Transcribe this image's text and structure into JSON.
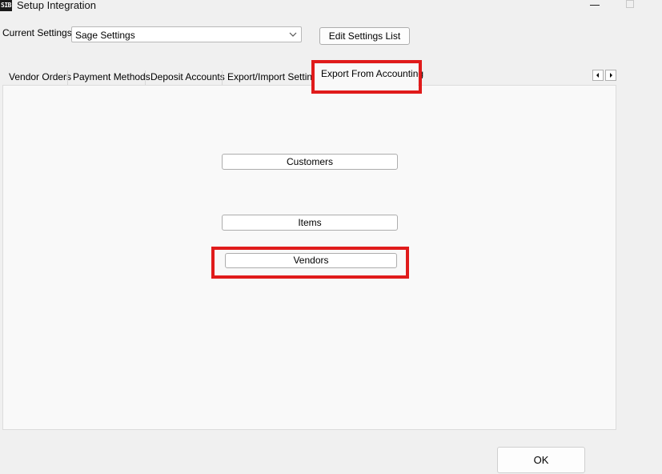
{
  "window": {
    "icon_text": "SIB",
    "title": "Setup Integration"
  },
  "settings": {
    "label": "Current Settings",
    "selected": "Sage Settings",
    "edit_button": "Edit Settings List"
  },
  "tabs": [
    {
      "label": "Vendor Orders",
      "selected": false
    },
    {
      "label": "Payment Methods",
      "selected": false
    },
    {
      "label": "Deposit Accounts",
      "selected": false
    },
    {
      "label": "Export/Import Settings",
      "selected": false
    },
    {
      "label": "Export From Accounting",
      "selected": true
    }
  ],
  "panel": {
    "buttons": {
      "customers": "Customers",
      "items": "Items",
      "vendors": "Vendors"
    }
  },
  "footer": {
    "ok_button": "OK"
  },
  "icons": [
    "app-icon",
    "minimize-icon",
    "maximize-icon",
    "dropdown-arrow-icon",
    "scroll-left-icon",
    "scroll-right-icon"
  ],
  "colors": {
    "highlight": "#e01b1b",
    "window_bg": "#f0f0f0",
    "panel_bg": "#f9f9f9"
  }
}
